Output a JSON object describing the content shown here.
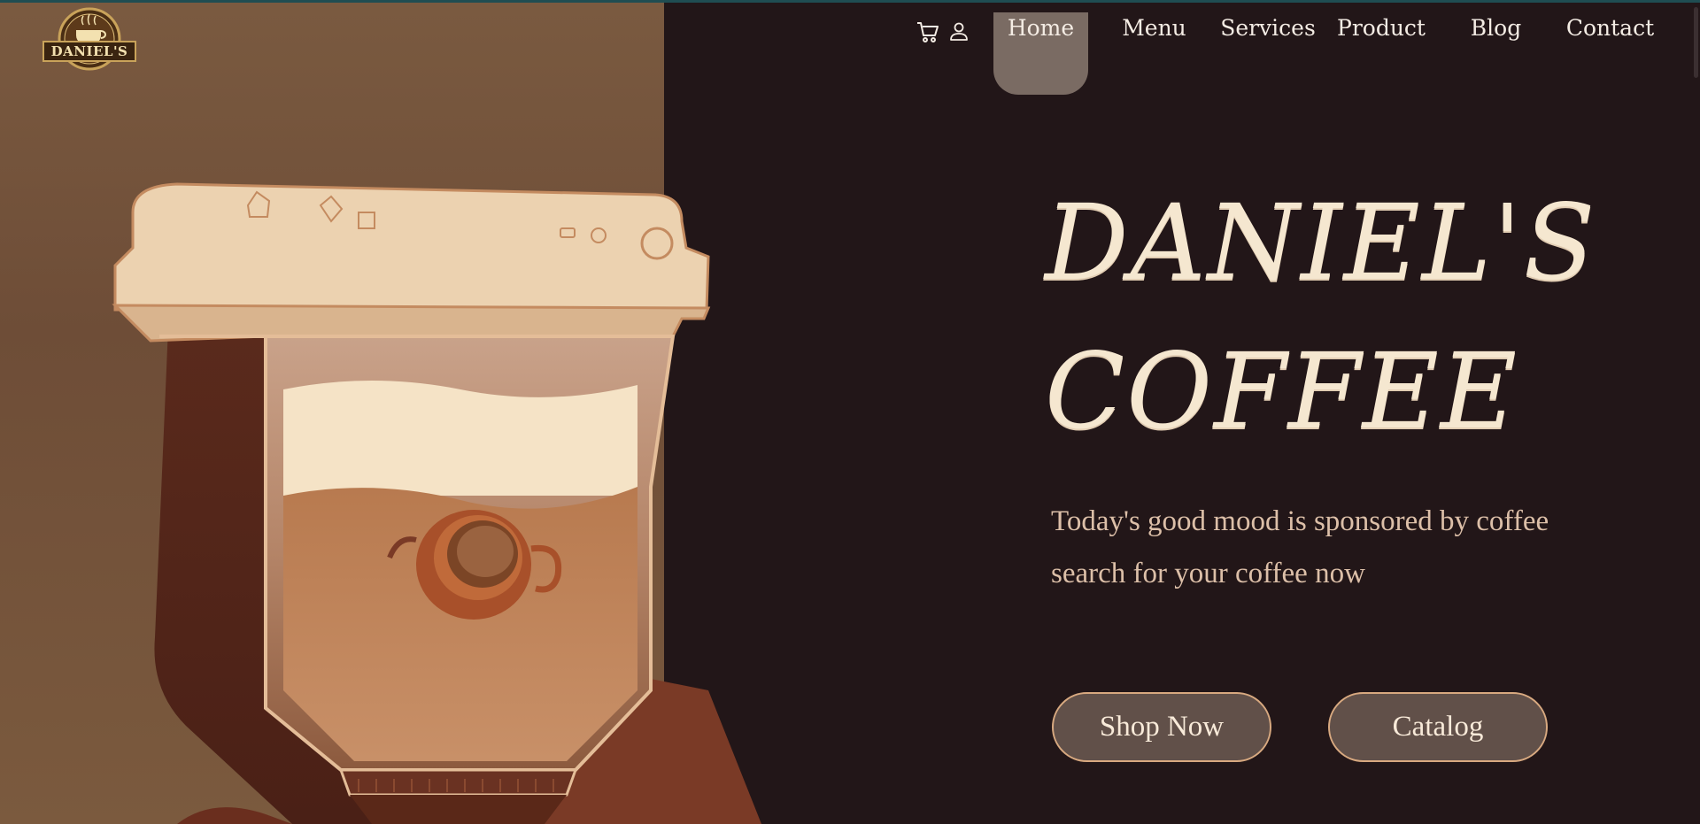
{
  "brand": {
    "logo_text": "DANIEL'S"
  },
  "nav": {
    "icons": [
      "cart-icon",
      "user-icon"
    ],
    "links": [
      "Home",
      "Menu",
      "Services",
      "Product",
      "Blog",
      "Contact"
    ],
    "active": "Home"
  },
  "hero": {
    "title_line1": "DANIEL'S",
    "title_line2": "COFFEE",
    "subtitle_line1": "Today's good mood is sponsored by coffee",
    "subtitle_line2": "search for your coffee now",
    "buttons": {
      "shop": "Shop Now",
      "catalog": "Catalog"
    }
  },
  "colors": {
    "background": "#221618",
    "left_panel": "#7a5a40",
    "title": "#f5e7d0",
    "button_fill": "#615049",
    "button_border": "#d8a980",
    "nav_active": "#7a6b63"
  }
}
